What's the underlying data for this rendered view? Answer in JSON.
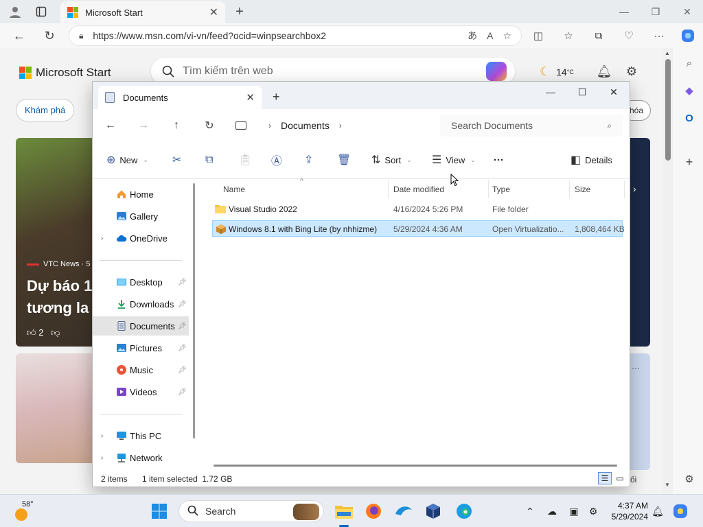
{
  "browser": {
    "tab_title": "Microsoft Start",
    "url": "https://www.msn.com/vi-vn/feed?ocid=winpsearchbox2"
  },
  "msn": {
    "logo_text": "Microsoft Start",
    "search_placeholder": "Tìm kiếm trên web",
    "temperature": "14",
    "temperature_unit": "°C",
    "explore_label": "Khám phá",
    "right_pill": "hóa",
    "card_source": "VTC News · 5",
    "card_headline_1": "Dự báo 1",
    "card_headline_2": "tương la",
    "card_likes": "2",
    "bottom_text": "ối"
  },
  "explorer": {
    "tab_title": "Documents",
    "breadcrumb": "Documents",
    "search_placeholder": "Search Documents",
    "commands": {
      "new": "New",
      "sort": "Sort",
      "view": "View",
      "more": "···",
      "details": "Details"
    },
    "sidebar": {
      "home": "Home",
      "gallery": "Gallery",
      "onedrive": "OneDrive",
      "desktop": "Desktop",
      "downloads": "Downloads",
      "documents": "Documents",
      "pictures": "Pictures",
      "music": "Music",
      "videos": "Videos",
      "thispc": "This PC",
      "network": "Network"
    },
    "columns": {
      "name": "Name",
      "date": "Date modified",
      "type": "Type",
      "size": "Size"
    },
    "files": [
      {
        "name": "Visual Studio 2022",
        "date": "4/16/2024 5:26 PM",
        "type": "File folder",
        "size": ""
      },
      {
        "name": "Windows 8.1 with Bing Lite (by nhhizme)",
        "date": "5/29/2024 4:36 AM",
        "type": "Open Virtualizatio...",
        "size": "1,808,464 KB"
      }
    ],
    "status": {
      "items": "2 items",
      "selected": "1 item selected  1.72 GB"
    }
  },
  "taskbar": {
    "weather_temp": "58°",
    "search_label": "Search",
    "time": "4:37 AM",
    "date": "5/29/2024"
  },
  "colors": {
    "accent": "#0067c0",
    "selection": "#cce8ff",
    "folder": "#f3c13a"
  }
}
